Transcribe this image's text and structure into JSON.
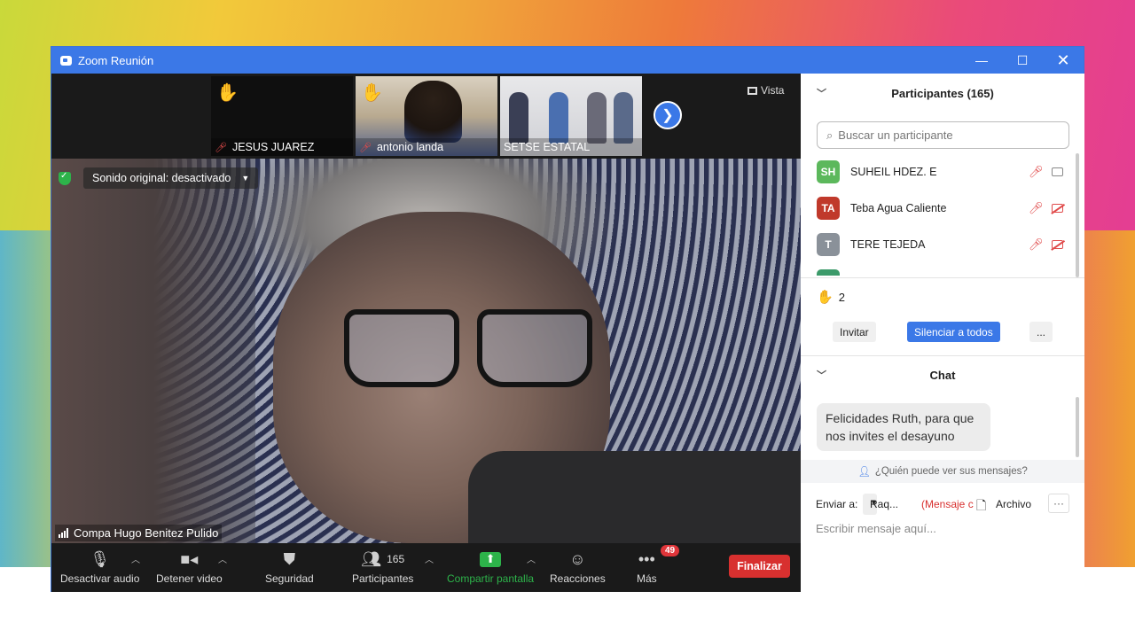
{
  "window": {
    "title": "Zoom Reunión"
  },
  "gallery": {
    "tiles": [
      {
        "name": "JESUS JUAREZ"
      },
      {
        "name": "antonio landa"
      },
      {
        "name": "SETSE ESTATAL"
      }
    ],
    "view_label": "Vista"
  },
  "main_video": {
    "sound_status": "Sonido original: desactivado",
    "speaker_name": "Compa Hugo Benitez Pulido"
  },
  "toolbar": {
    "mute_label": "Desactivar audio",
    "video_label": "Detener video",
    "security_label": "Seguridad",
    "participants_label": "Participantes",
    "participants_count": "165",
    "share_label": "Compartir pantalla",
    "reactions_label": "Reacciones",
    "more_label": "Más",
    "more_badge": "49",
    "end_label": "Finalizar"
  },
  "participants": {
    "header": "Participantes (165)",
    "search_placeholder": "Buscar un participante",
    "list": [
      {
        "initials": "SH",
        "name": "SUHEIL HDEZ. E",
        "color": "#5cb85c",
        "cam_off": false
      },
      {
        "initials": "TA",
        "name": "Teba Agua Caliente",
        "color": "#c0392b",
        "cam_off": true
      },
      {
        "initials": "T",
        "name": "TERE TEJEDA",
        "color": "#8a9199",
        "cam_off": true
      }
    ],
    "raised_hands": "2",
    "invite_label": "Invitar",
    "mute_all_label": "Silenciar a todos",
    "more_label": "..."
  },
  "chat": {
    "header": "Chat",
    "message": "Felicidades Ruth, para que nos invites el desayuno",
    "who_can_see": "¿Quién puede ver sus mensajes?",
    "send_to_label": "Enviar a:",
    "recipient": "Raq...",
    "private_hint": "(Mensaje c",
    "file_label": "Archivo",
    "input_placeholder": "Escribir mensaje aquí..."
  },
  "colors": {
    "zoom_blue": "#3b78e7",
    "end_red": "#d8302f",
    "share_green": "#2db34a",
    "hand_yellow": "#f7c433"
  }
}
